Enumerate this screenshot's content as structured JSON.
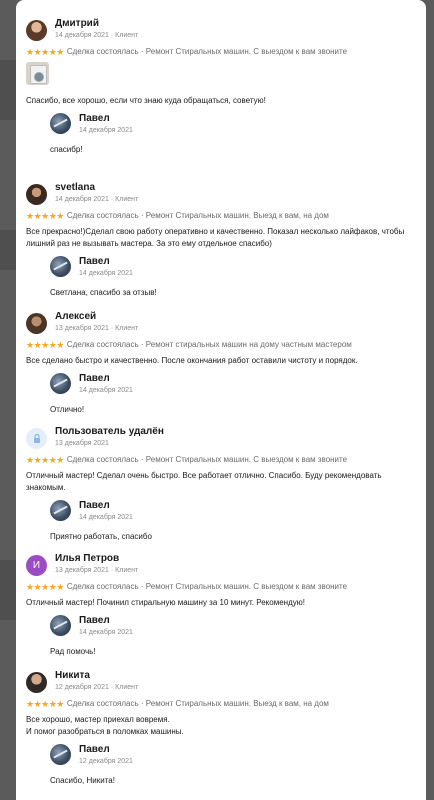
{
  "reviews": [
    {
      "name": "Дмитрий",
      "meta": "14 декабря 2021 · Клиент",
      "stars": "★★★★★",
      "deal": "Сделка состоялась · Ремонт Стиральных машин. С выездом к вам звоните",
      "text": "Спасибо, все хорошо, если что знаю куда обращаться, советую!",
      "has_photo": true,
      "reply": {
        "name": "Павел",
        "date": "14 декабря 2021",
        "text": "спасибр!"
      }
    },
    {
      "name": "svetlana",
      "meta": "14 декабря 2021 · Клиент",
      "stars": "★★★★★",
      "deal": "Сделка состоялась · Ремонт Стиральных машин. Выезд к вам, на дом",
      "text": "Все прекрасно!)Сделал свою работу оперативно и качественно. Показал несколько лайфаков, чтобы лишний раз не вызывать мастера. За это ему отдельное спасибо)",
      "reply": {
        "name": "Павел",
        "date": "14 декабря 2021",
        "text": "Светлана, спасибо за отзыв!"
      }
    },
    {
      "name": "Алексей",
      "meta": "13 декабря 2021 · Клиент",
      "stars": "★★★★★",
      "deal": "Сделка состоялась · Ремонт стиральных машин на дому частным мастером",
      "text": "Все сделано быстро и качественно. После окончания работ оставили чистоту и порядок.",
      "reply": {
        "name": "Павел",
        "date": "14 декабря 2021",
        "text": "Отлично!"
      }
    },
    {
      "name": "Пользователь удалён",
      "meta": "13 декабря 2021",
      "stars": "★★★★★",
      "deal": "Сделка состоялась · Ремонт Стиральных машин. С выездом к вам звоните",
      "text": "Отличный мастер! Сделал очень быстро. Все работает отлично. Спасибо. Буду рекомендовать знакомым.",
      "reply": {
        "name": "Павел",
        "date": "14 декабря 2021",
        "text": "Приятно работать, спасибо"
      }
    },
    {
      "name": "Илья Петров",
      "meta": "13 декабря 2021 · Клиент",
      "avatar_letter": "И",
      "stars": "★★★★★",
      "deal": "Сделка состоялась · Ремонт Стиральных машин. С выездом к вам звоните",
      "text": "Отличный мастер! Починил стиральную машину за 10 минут. Рекомендую!",
      "reply": {
        "name": "Павел",
        "date": "14 декабря 2021",
        "text": "Рад помочь!"
      }
    },
    {
      "name": "Никита",
      "meta": "12 декабря 2021 · Клиент",
      "stars": "★★★★★",
      "deal": "Сделка состоялась · Ремонт Стиральных машин. Выезд к вам, на дом",
      "text_lines": [
        "Все хорошо, мастер приехал вовремя.",
        "И помог разобраться в поломках машины."
      ],
      "reply": {
        "name": "Павел",
        "date": "12 декабря 2021",
        "text": "Спасибо, Никита!"
      }
    }
  ]
}
